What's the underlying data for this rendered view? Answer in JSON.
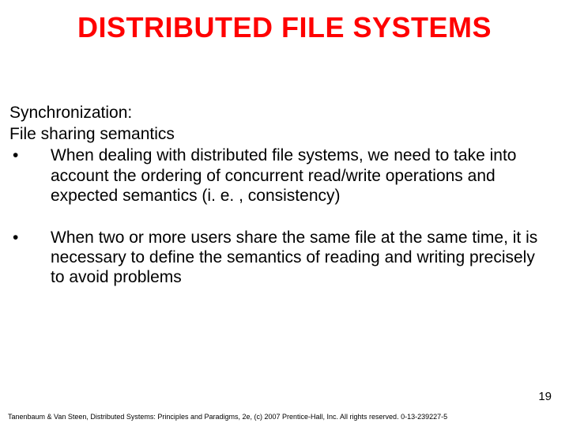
{
  "title": "DISTRIBUTED FILE SYSTEMS",
  "subhead1": "Synchronization:",
  "subhead2": "File sharing semantics",
  "bullets": [
    "When dealing with distributed file systems, we need to take into account the ordering of concurrent read/write operations and expected semantics (i. e. , consistency)",
    "When two or more users share the same file at the same time, it is necessary to define the semantics of reading and writing precisely to avoid problems"
  ],
  "bullet_mark": "•",
  "page_number": "19",
  "footer": "Tanenbaum & Van Steen, Distributed Systems: Principles and Paradigms, 2e, (c) 2007 Prentice-Hall, Inc. All rights reserved. 0-13-239227-5"
}
